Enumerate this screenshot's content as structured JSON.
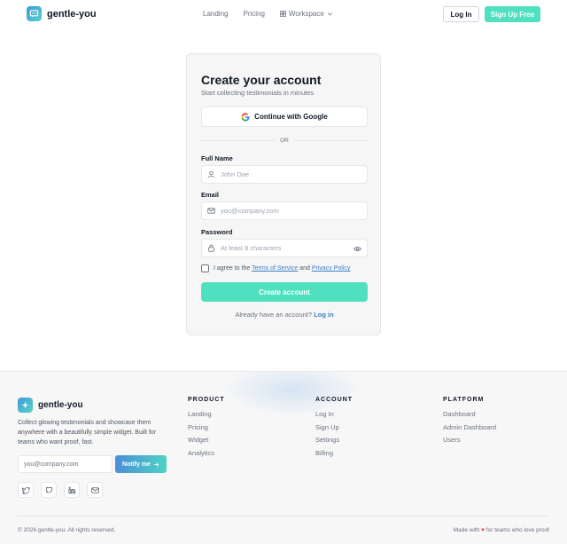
{
  "nav": {
    "brand": "gentle-you",
    "links": [
      "Landing",
      "Pricing",
      "Workspace"
    ],
    "login": "Log In",
    "signup": "Sign Up Free"
  },
  "signup_card": {
    "title": "Create your account",
    "subtitle": "Start collecting testimonials in minutes",
    "google_button": "Continue with Google",
    "divider": "OR",
    "full_name_label": "Full Name",
    "full_name_placeholder": "John Doe",
    "email_label": "Email",
    "email_placeholder": "you@company.com",
    "password_label": "Password",
    "password_placeholder": "At least 8 characters",
    "terms_prefix": "I agree to the",
    "terms_link": "Terms of Service",
    "terms_and": "and",
    "privacy_link": "Privacy Policy",
    "create_button": "Create account",
    "already_text": "Already have an account?",
    "login_link": "Log in"
  },
  "footer": {
    "brand": "gentle-you",
    "description": "Collect glowing testimonials and showcase them anywhere with a beautifully simple widget. Built for teams who want proof, fast.",
    "email_placeholder": "you@company.com",
    "notify_button": "Notify me",
    "columns": [
      {
        "heading": "PRODUCT",
        "items": [
          "Landing",
          "Pricing",
          "Widget",
          "Analytics"
        ]
      },
      {
        "heading": "ACCOUNT",
        "items": [
          "Log In",
          "Sign Up",
          "Settings",
          "Billing"
        ]
      },
      {
        "heading": "PLATFORM",
        "items": [
          "Dashboard",
          "Admin Dashboard",
          "Users"
        ]
      }
    ],
    "copyright": "© 2026 gentle-you. All rights reserved.",
    "made_prefix": "Made with",
    "made_suffix": "for teams who love proof"
  },
  "colors": {
    "accent": "#4fe0c0",
    "link": "#3b82c4",
    "brand_gradient_start": "#3b9ad9",
    "brand_gradient_end": "#5ad1c9"
  },
  "icons": [
    "chat-logo-icon",
    "grid-icon",
    "chevron-down-icon",
    "google-icon",
    "user-icon",
    "mail-icon",
    "lock-icon",
    "eye-icon",
    "arrow-right-icon",
    "twitter-icon",
    "github-icon",
    "linkedin-icon",
    "heart-icon"
  ]
}
